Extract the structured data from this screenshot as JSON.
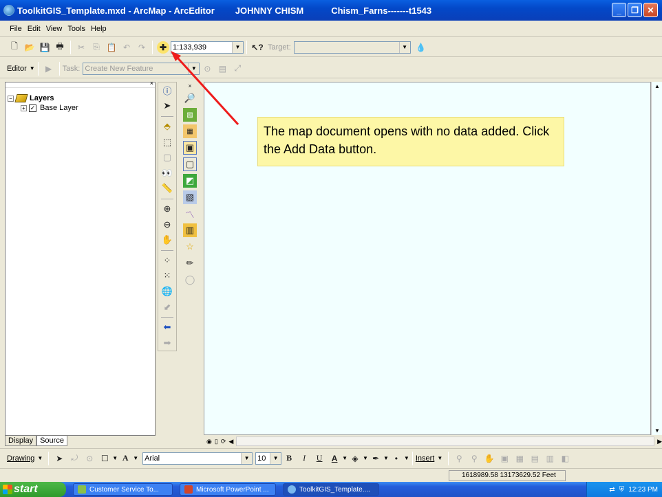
{
  "window": {
    "title": "ToolkitGIS_Template.mxd - ArcMap - ArcEditor",
    "user": "JOHNNY CHISM",
    "project": "Chism_Farns-------t1543"
  },
  "menu": [
    "File",
    "Edit",
    "View",
    "Tools",
    "Help"
  ],
  "toolbar": {
    "scale": "1:133,939",
    "target_label": "Target:"
  },
  "editor": {
    "label": "Editor",
    "task_label": "Task:",
    "task_value": "Create New Feature"
  },
  "toc": {
    "root": "Layers",
    "layers": [
      "Base Layer"
    ],
    "tabs": [
      "Display",
      "Source"
    ]
  },
  "callout": {
    "text": "The map document opens with no data added. Click the Add Data button."
  },
  "drawing": {
    "label": "Drawing",
    "font": "Arial",
    "size": "10",
    "insert": "Insert"
  },
  "status": {
    "coords": "1618989.58  13173629.52 Feet"
  },
  "taskbar": {
    "start": "start",
    "items": [
      "Customer Service To...",
      "Microsoft PowerPoint ...",
      "ToolkitGIS_Template...."
    ],
    "clock": "12:23 PM"
  },
  "colors": {
    "map_bg": "#f2ffff",
    "callout_bg": "#fdf7a6",
    "arrow": "#ee1c1c"
  }
}
